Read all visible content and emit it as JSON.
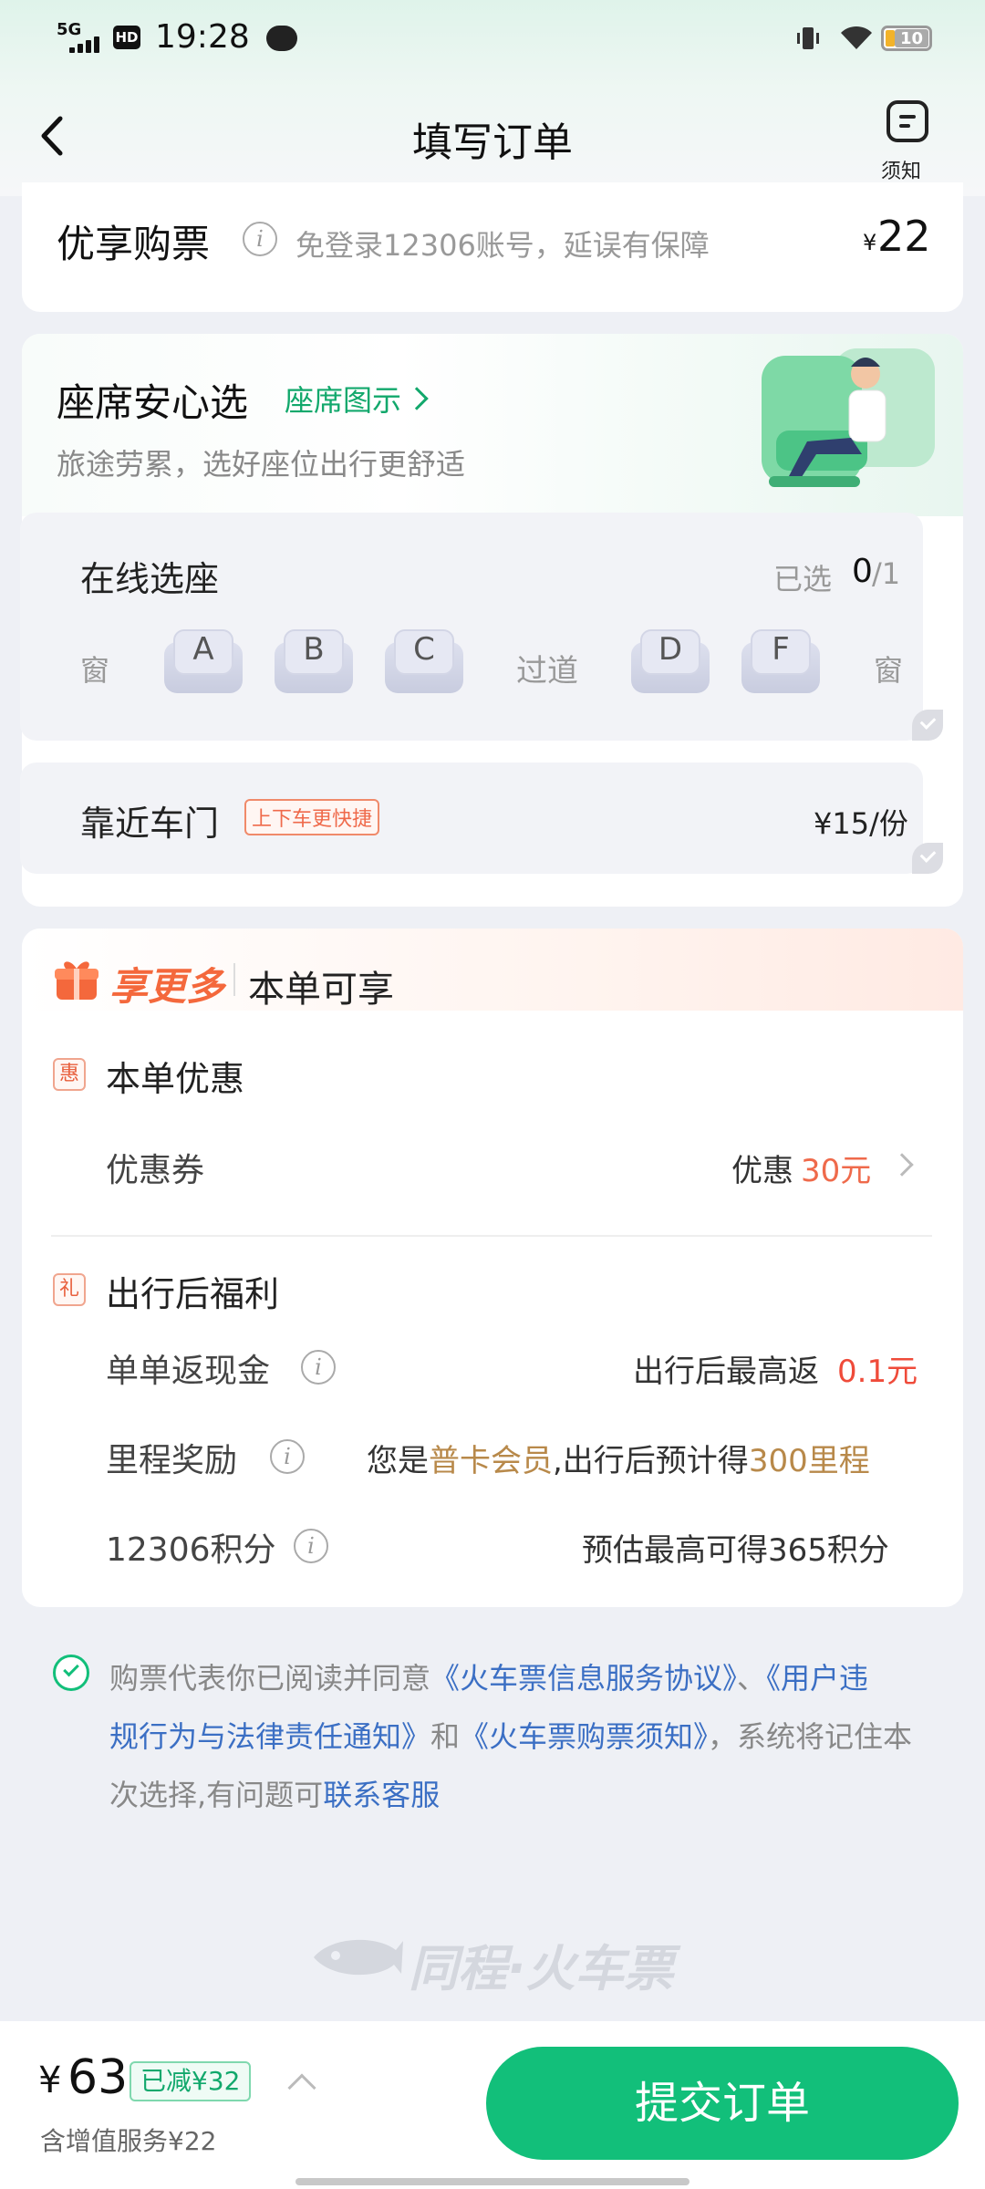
{
  "status_bar": {
    "network": "5G",
    "hd": "HD",
    "time": "19:28",
    "battery": "10"
  },
  "header": {
    "title": "填写订单",
    "notice_label": "须知"
  },
  "premium": {
    "label": "优享购票",
    "desc": "免登录12306账号，延误有保障",
    "currency": "¥",
    "price": "22"
  },
  "seat_section": {
    "title": "座席安心选",
    "diagram_link": "座席图示",
    "subtitle": "旅途劳累，选好座位出行更舒适",
    "online": {
      "title": "在线选座",
      "selected_label": "已选",
      "selected_count": "0",
      "selected_total": "/1",
      "window_left": "窗",
      "aisle": "过道",
      "window_right": "窗",
      "seats": [
        "A",
        "B",
        "C",
        "D",
        "F"
      ]
    },
    "door": {
      "title": "靠近车门",
      "tag": "上下车更快捷",
      "price": "¥15/份"
    }
  },
  "benefits": {
    "brand": "享更多",
    "header": "本单可享",
    "discount_section": {
      "icon": "惠",
      "title": "本单优惠"
    },
    "coupon": {
      "label": "优惠券",
      "prefix": "优惠",
      "value": "30元"
    },
    "after_section": {
      "icon": "礼",
      "title": "出行后福利"
    },
    "cashback": {
      "label": "单单返现金",
      "prefix": "出行后最高返",
      "value": "0.1元"
    },
    "mileage": {
      "label": "里程奖励",
      "p1": "您是",
      "member": "普卡会员",
      "p2": ",出行后预计得",
      "miles": "300里程"
    },
    "points": {
      "label": "12306积分",
      "value": "预估最高可得365积分"
    }
  },
  "agreement": {
    "line1_prefix": "购票代表你已阅读并同意",
    "link1": "《火车票信息服务协议》",
    "sep1": "、",
    "link2_part1": "《用户违",
    "link2_part2": "规行为与法律责任通知》",
    "and": "和",
    "link3": "《火车票购票须知》",
    "line2_suffix": "，系统将记住本",
    "line3_prefix": "次选择,有问题可",
    "link4": "联系客服"
  },
  "watermark": "同程·火车票",
  "footer": {
    "currency": "¥",
    "total": "63",
    "saved": "已减¥32",
    "service_note": "含增值服务¥22",
    "submit": "提交订单"
  },
  "colors": {
    "brand_green": "#12bf7a",
    "accent_orange": "#ef6a4b",
    "link_blue": "#3b6fc4",
    "gold": "#b8894a"
  }
}
